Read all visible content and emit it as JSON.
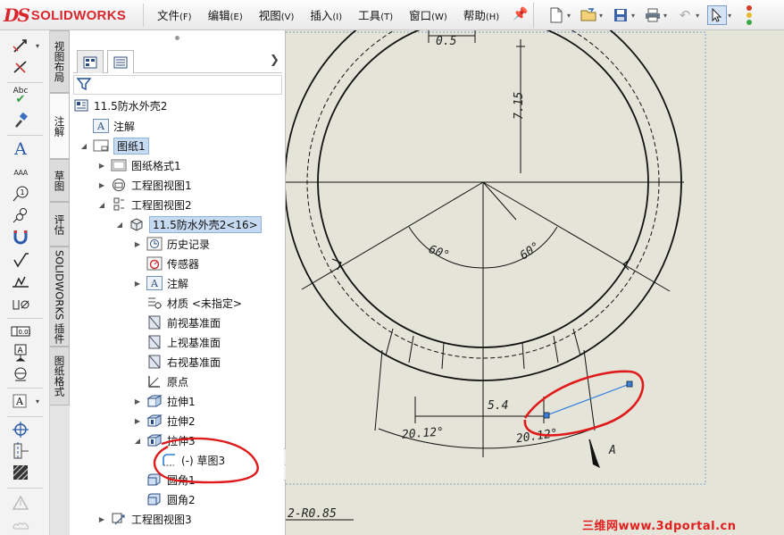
{
  "app": {
    "logo_mark": "DS",
    "logo_name": "SOLIDWORKS"
  },
  "menu": [
    {
      "label": "文件",
      "accel": "(F)"
    },
    {
      "label": "编辑",
      "accel": "(E)"
    },
    {
      "label": "视图",
      "accel": "(V)"
    },
    {
      "label": "插入",
      "accel": "(I)"
    },
    {
      "label": "工具",
      "accel": "(T)"
    },
    {
      "label": "窗口",
      "accel": "(W)"
    },
    {
      "label": "帮助",
      "accel": "(H)"
    }
  ],
  "toolbar_icons": [
    "new-document-icon",
    "open-folder-icon",
    "save-icon",
    "print-icon",
    "undo-icon",
    "select-pointer-icon",
    "traffic-light-icon"
  ],
  "command_tabs": [
    "视图布局",
    "注解",
    "草图",
    "评估",
    "SOLIDWORKS 插件",
    "图纸格式"
  ],
  "left_tool_labels": {
    "spell": "Abc",
    "note_a": "A",
    "abc_small": "AAA",
    "balloon_num": "1",
    "frame_text": "0.03"
  },
  "tree": [
    {
      "id": "root",
      "label": "11.5防水外壳2",
      "icon": "drawing-doc-icon"
    },
    {
      "id": "annotations",
      "label": "注解",
      "icon": "annotation-icon"
    },
    {
      "id": "sheet1",
      "label": "图纸1",
      "icon": "sheet-icon"
    },
    {
      "id": "sheet-format1",
      "label": "图纸格式1",
      "icon": "sheet-format-icon"
    },
    {
      "id": "view1",
      "label": "工程图视图1",
      "icon": "drawing-view-icon"
    },
    {
      "id": "view2",
      "label": "工程图视图2",
      "icon": "drawing-view-icon"
    },
    {
      "id": "part",
      "label": "11.5防水外壳2<16>",
      "icon": "part-icon"
    },
    {
      "id": "history",
      "label": "历史记录",
      "icon": "history-icon"
    },
    {
      "id": "sensors",
      "label": "传感器",
      "icon": "sensor-icon"
    },
    {
      "id": "part-annotations",
      "label": "注解",
      "icon": "annotation-icon"
    },
    {
      "id": "material",
      "label": "材质 <未指定>",
      "icon": "material-icon"
    },
    {
      "id": "front-plane",
      "label": "前视基准面",
      "icon": "plane-icon"
    },
    {
      "id": "top-plane",
      "label": "上视基准面",
      "icon": "plane-icon"
    },
    {
      "id": "right-plane",
      "label": "右视基准面",
      "icon": "plane-icon"
    },
    {
      "id": "origin",
      "label": "原点",
      "icon": "origin-icon"
    },
    {
      "id": "extrude1",
      "label": "拉伸1",
      "icon": "extrude-icon"
    },
    {
      "id": "extrude2",
      "label": "拉伸2",
      "icon": "extrude-icon"
    },
    {
      "id": "extrude3",
      "label": "拉伸3",
      "icon": "extrude-icon"
    },
    {
      "id": "sketch3",
      "label": "(-) 草图3",
      "icon": "sketch-icon"
    },
    {
      "id": "fillet1",
      "label": "圆角1",
      "icon": "fillet-icon"
    },
    {
      "id": "fillet2",
      "label": "圆角2",
      "icon": "fillet-icon"
    },
    {
      "id": "view3",
      "label": "工程图视图3",
      "icon": "drawing-view-icon"
    }
  ],
  "drawing": {
    "dims": {
      "d_top": "0.5",
      "d_vert": "7.15",
      "angle_left": "60°",
      "angle_right": "60°",
      "d_mid": "5.4",
      "arc_left": "20.12°",
      "arc_right": "20.12°",
      "fillet": "2-R0.85",
      "section": "A"
    },
    "annotation_color": "#e01a1a",
    "sketch_line_color": "#2b7be0"
  },
  "watermark": "三维网www.3dportal.cn"
}
